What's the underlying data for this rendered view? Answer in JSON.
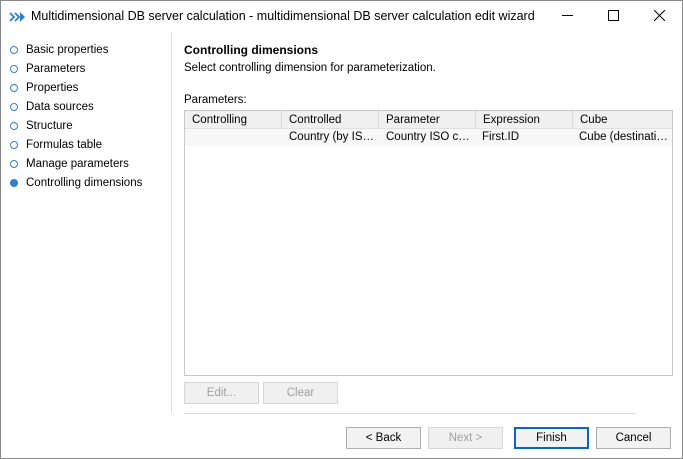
{
  "window": {
    "title": "Multidimensional DB server calculation - multidimensional DB server calculation edit wizard",
    "app_icon": "double-chevron-right-icon",
    "controls": [
      "minimize-icon",
      "maximize-icon",
      "close-icon"
    ],
    "accent": "#2f80c8"
  },
  "sidebar": {
    "items": [
      {
        "label": "Basic properties",
        "active": false
      },
      {
        "label": "Parameters",
        "active": false
      },
      {
        "label": "Properties",
        "active": false
      },
      {
        "label": "Data sources",
        "active": false
      },
      {
        "label": "Structure",
        "active": false
      },
      {
        "label": "Formulas table",
        "active": false
      },
      {
        "label": "Manage parameters",
        "active": false
      },
      {
        "label": "Controlling dimensions",
        "active": true
      }
    ]
  },
  "main": {
    "heading": "Controlling dimensions",
    "description": "Select controlling dimension for parameterization.",
    "parameters_label": "Parameters:",
    "columns": [
      "Controlling",
      "Controlled",
      "Parameter",
      "Expression",
      "Cube"
    ],
    "rows": [
      {
        "controlling": "",
        "controlled": "Country (by ISO…",
        "parameter": "Country ISO code",
        "expression": "First.ID",
        "cube": "Cube (destinatio…"
      }
    ],
    "edit_label": "Edit...",
    "clear_label": "Clear"
  },
  "footer": {
    "back_label": "< Back",
    "next_label": "Next >",
    "finish_label": "Finish",
    "cancel_label": "Cancel"
  }
}
